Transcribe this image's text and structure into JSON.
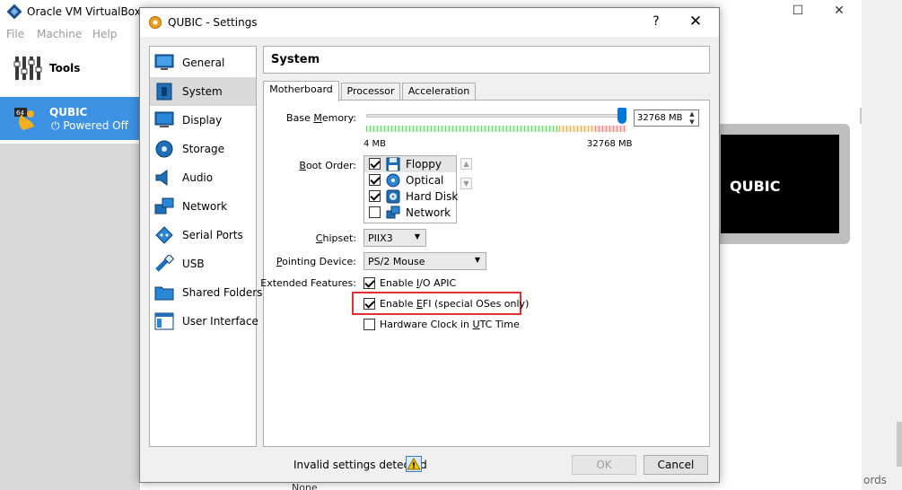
{
  "manager": {
    "title": "Oracle VM VirtualBox M",
    "menu": [
      "File",
      "Machine",
      "Help"
    ],
    "tools_label": "Tools",
    "vm": {
      "name": "QUBIC",
      "state": "Powered Off",
      "badge": "64"
    },
    "preview_label": "QUBIC",
    "cut_text": "ords",
    "cut_none": "None"
  },
  "dialog": {
    "title": "QUBIC - Settings",
    "help": "?",
    "close": "✕",
    "sidebar": [
      {
        "label": "General",
        "icon": "general-icon"
      },
      {
        "label": "System",
        "icon": "system-icon",
        "selected": true
      },
      {
        "label": "Display",
        "icon": "display-icon"
      },
      {
        "label": "Storage",
        "icon": "storage-icon"
      },
      {
        "label": "Audio",
        "icon": "audio-icon"
      },
      {
        "label": "Network",
        "icon": "network-icon"
      },
      {
        "label": "Serial Ports",
        "icon": "serial-ports-icon"
      },
      {
        "label": "USB",
        "icon": "usb-icon"
      },
      {
        "label": "Shared Folders",
        "icon": "shared-folders-icon"
      },
      {
        "label": "User Interface",
        "icon": "user-interface-icon"
      }
    ],
    "section_title": "System",
    "tabs": [
      {
        "label": "Motherboard",
        "active": true
      },
      {
        "label": "Processor"
      },
      {
        "label": "Acceleration"
      }
    ],
    "base_memory": {
      "label_pre": "Base ",
      "label_u": "M",
      "label_post": "emory:",
      "value": "32768 MB",
      "slider_fraction": 1.0,
      "min_label": "4 MB",
      "max_label": "32768 MB"
    },
    "boot_order": {
      "label_pre": "",
      "label_u": "B",
      "label_post": "oot Order:",
      "items": [
        {
          "label": "Floppy",
          "checked": true,
          "icon": "floppy-icon",
          "selected": true
        },
        {
          "label": "Optical",
          "checked": true,
          "icon": "optical-icon"
        },
        {
          "label": "Hard Disk",
          "checked": true,
          "icon": "hard-disk-icon"
        },
        {
          "label": "Network",
          "checked": false,
          "icon": "network-boot-icon"
        }
      ],
      "up": "▲",
      "down": "▼"
    },
    "chipset": {
      "label_pre": "",
      "label_u": "C",
      "label_post": "hipset:",
      "value": "PIIX3"
    },
    "pointing_device": {
      "label_pre": "",
      "label_u": "P",
      "label_post": "ointing Device:",
      "value": "PS/2 Mouse"
    },
    "extended_features": {
      "label": "Extended Features:",
      "items": [
        {
          "pre": "Enable ",
          "u": "I",
          "post": "/O APIC",
          "checked": true
        },
        {
          "pre": "Enable ",
          "u": "E",
          "post": "FI (special OSes only)",
          "checked": true,
          "highlighted": true
        },
        {
          "pre": "Hardware Clock in ",
          "u": "U",
          "post": "TC Time",
          "checked": false
        }
      ]
    },
    "status_text": "Invalid settings detected",
    "ok_label": "OK",
    "cancel_label": "Cancel"
  },
  "colors": {
    "selection_blue": "#3d92e3",
    "slider_thumb": "#0078d7",
    "highlight_red": "#e03030"
  }
}
